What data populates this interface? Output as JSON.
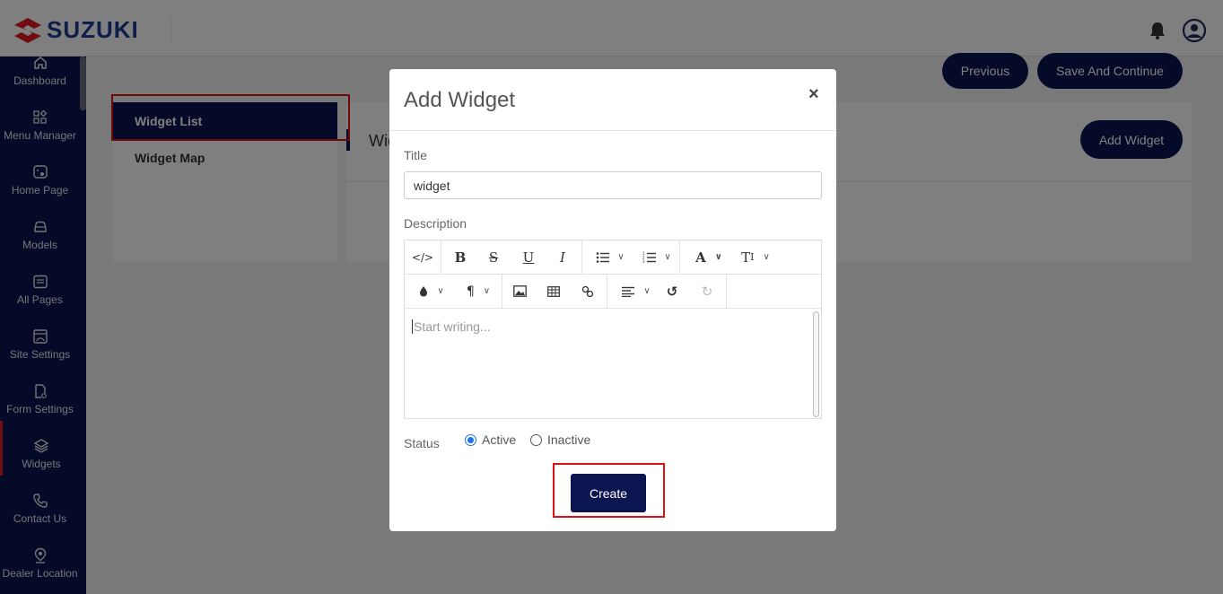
{
  "header": {
    "brand": "SUZUKI"
  },
  "sidebar": {
    "items": [
      {
        "label": "Dashboard",
        "icon": "home-icon"
      },
      {
        "label": "Menu Manager",
        "icon": "grid-icon"
      },
      {
        "label": "Home Page",
        "icon": "home-page-icon"
      },
      {
        "label": "Models",
        "icon": "car-icon"
      },
      {
        "label": "All Pages",
        "icon": "pages-icon"
      },
      {
        "label": "Site Settings",
        "icon": "site-settings-icon"
      },
      {
        "label": "Form Settings",
        "icon": "form-settings-icon"
      },
      {
        "label": "Widgets",
        "icon": "layers-icon"
      },
      {
        "label": "Contact Us",
        "icon": "phone-icon"
      },
      {
        "label": "Dealer Location",
        "icon": "location-icon"
      }
    ],
    "active_index": 7
  },
  "content": {
    "previous_label": "Previous",
    "save_continue_label": "Save And Continue",
    "tabs": [
      "Widget List",
      "Widget Map"
    ],
    "panel_title": "Widget List",
    "add_widget_label": "Add Widget"
  },
  "modal": {
    "title": "Add Widget",
    "close_label": "×",
    "title_label": "Title",
    "title_value": "widget",
    "description_label": "Description",
    "placeholder": "Start writing...",
    "status_label": "Status",
    "status_options": [
      "Active",
      "Inactive"
    ],
    "status_selected": "Active",
    "create_label": "Create"
  },
  "colors": {
    "navy": "#0b1550",
    "highlight": "#e01010",
    "radio_accent": "#1a73e8"
  }
}
